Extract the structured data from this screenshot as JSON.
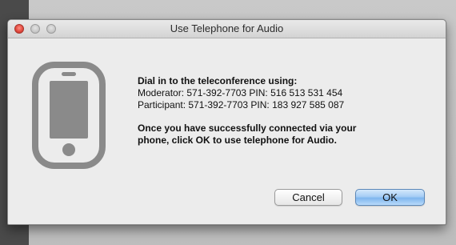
{
  "window": {
    "title": "Use Telephone for Audio"
  },
  "icon": {
    "name": "mobile-phone-icon",
    "color": "#8a8a8a"
  },
  "message": {
    "heading": "Dial in to the teleconference using:",
    "moderator": "Moderator: 571-392-7703 PIN: 516 513 531 454",
    "participant": "Participant: 571-392-7703 PIN: 183 927 585 087",
    "instructions_line1": "Once you have successfully connected via your",
    "instructions_line2": "phone, click OK to use telephone for Audio."
  },
  "buttons": {
    "cancel_label": "Cancel",
    "ok_label": "OK"
  },
  "colors": {
    "close_button": "#e0463b",
    "default_button": "#7fb6ee"
  }
}
